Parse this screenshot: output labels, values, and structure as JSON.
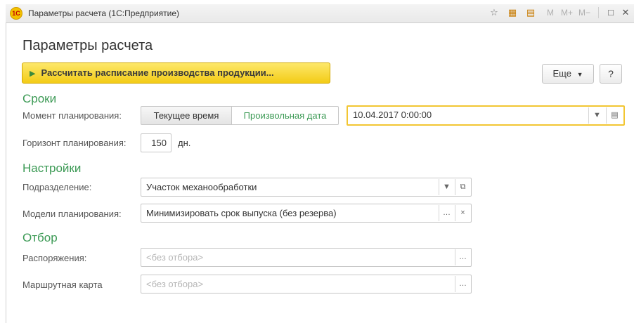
{
  "window": {
    "title": "Параметры расчета  (1С:Предприятие)",
    "logo": "1C",
    "toolbar_m": [
      "M",
      "M+",
      "M−"
    ],
    "icons": [
      "favorite-icon",
      "calculator-icon",
      "calendar-icon",
      "maximize-icon",
      "close-icon"
    ]
  },
  "form": {
    "title": "Параметры расчета",
    "run_button": "Рассчитать расписание производства продукции...",
    "more_button": "Еще",
    "help_button": "?"
  },
  "terms": {
    "section": "Сроки",
    "moment_label": "Момент планирования:",
    "option_current": "Текущее время",
    "option_custom": "Произвольная дата",
    "date_value": "10.04.2017  0:00:00",
    "horizon_label": "Горизонт планирования:",
    "horizon_value": "150",
    "horizon_unit": "дн."
  },
  "settings": {
    "section": "Настройки",
    "department_label": "Подразделение:",
    "department_value": "Участок механообработки",
    "models_label": "Модели планирования:",
    "models_value": "Минимизировать срок выпуска (без резерва)"
  },
  "filter": {
    "section": "Отбор",
    "orders_label": "Распоряжения:",
    "orders_placeholder": "<без отбора>",
    "route_label": "Маршрутная карта",
    "route_placeholder": "<без отбора>"
  },
  "colors": {
    "accent_green": "#3c9a55",
    "run_button_yellow": "#f3cc16",
    "active_border": "#f2c633"
  }
}
